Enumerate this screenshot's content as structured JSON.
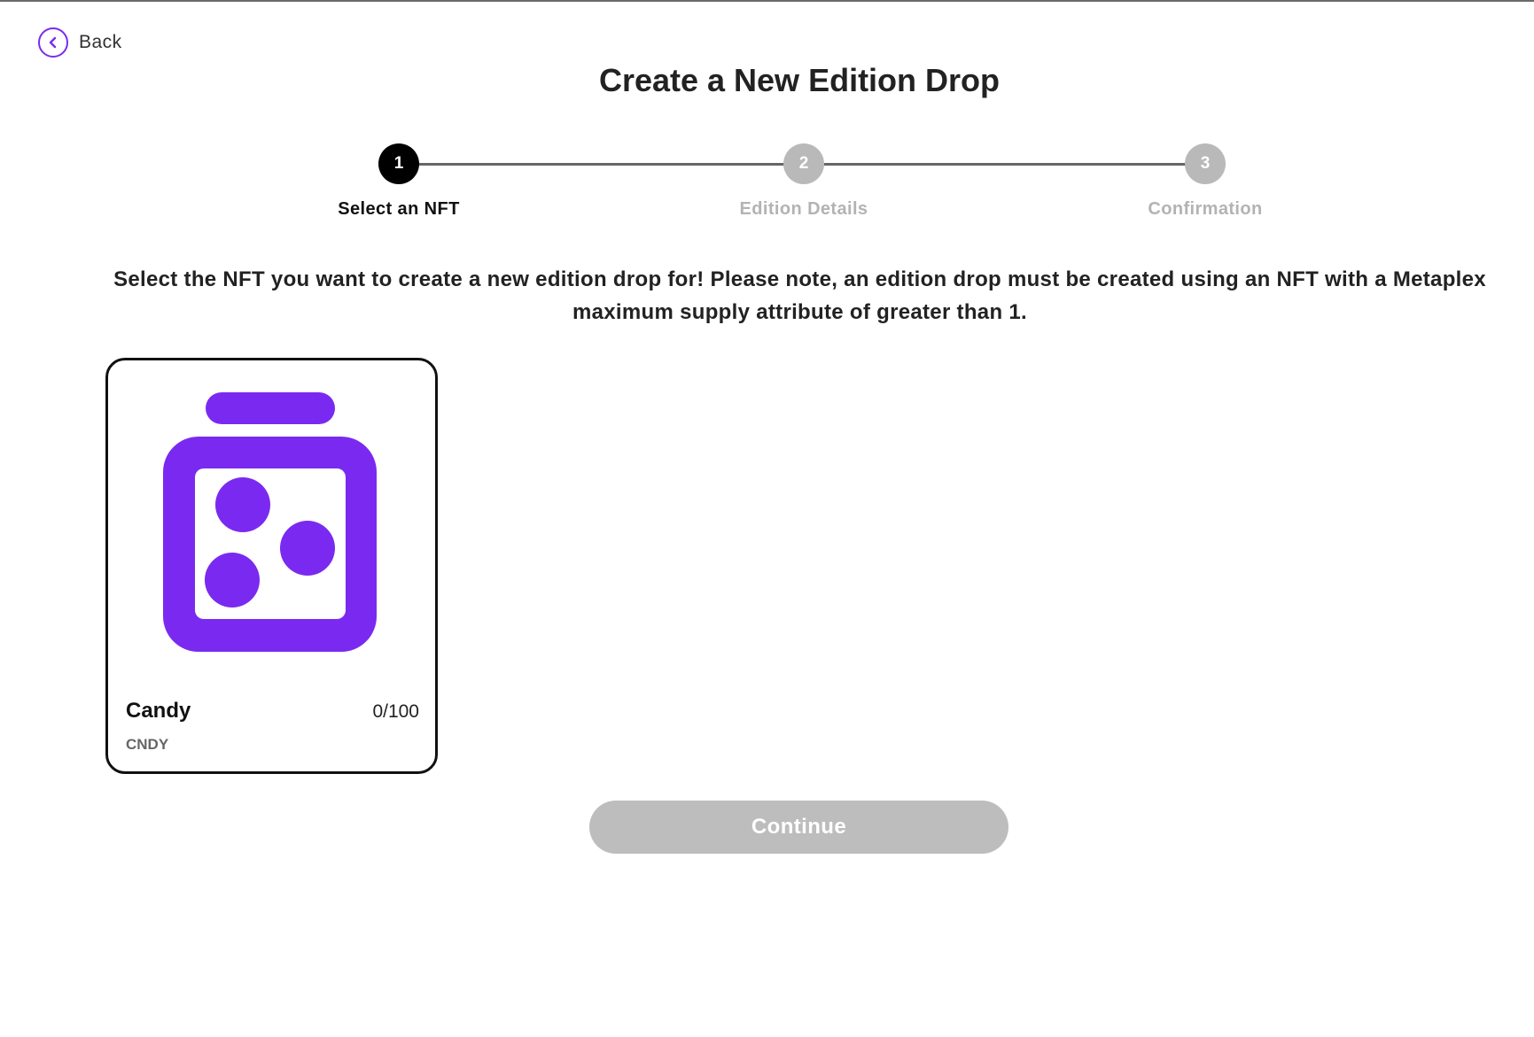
{
  "back": {
    "label": "Back",
    "icon": "chevron-left-icon"
  },
  "title": "Create a New Edition Drop",
  "stepper": {
    "steps": [
      {
        "number": "1",
        "label": "Select an NFT",
        "state": "active"
      },
      {
        "number": "2",
        "label": "Edition Details",
        "state": "inactive"
      },
      {
        "number": "3",
        "label": "Confirmation",
        "state": "inactive"
      }
    ]
  },
  "instructions": "Select the NFT you want to create a new edition drop for! Please note, an edition drop must be created using an NFT with a Metaplex maximum supply attribute of greater than 1.",
  "nfts": [
    {
      "name": "Candy",
      "symbol": "CNDY",
      "supply": "0/100",
      "icon": "candy-jar-icon"
    }
  ],
  "continue_button": {
    "label": "Continue",
    "disabled": true
  },
  "colors": {
    "accent": "#7a2af0",
    "active_step": "#000000",
    "inactive_step": "#b9b9b9",
    "disabled_button": "#bdbdbd"
  }
}
